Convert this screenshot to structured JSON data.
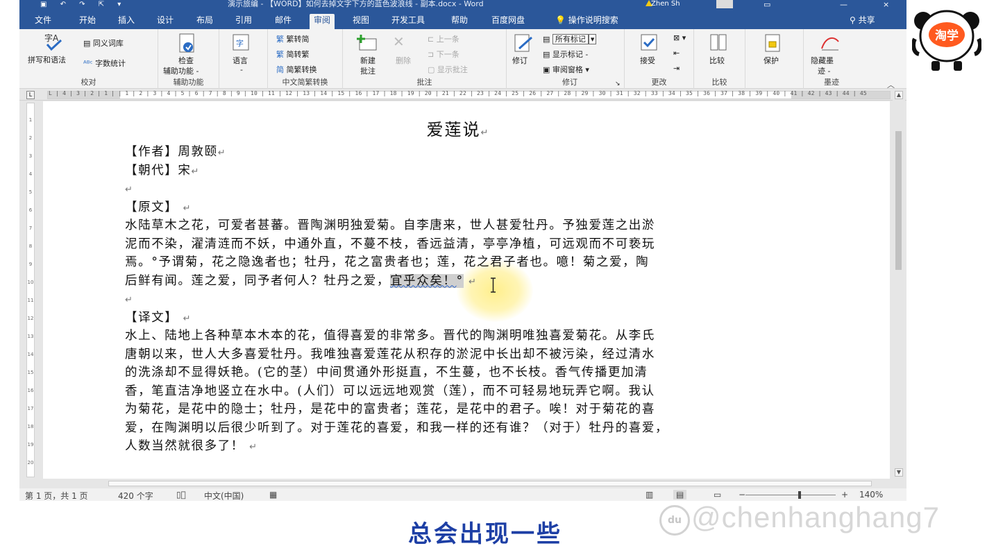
{
  "titlebar": {
    "title": "演示旅编 - 【WORD】如何去掉文字下方的蓝色波浪线 - 副本.docx - Word",
    "user": "Zhen Sh",
    "window_controls": [
      "—",
      "□",
      "×"
    ]
  },
  "tabs": [
    {
      "label": "文件",
      "active": false
    },
    {
      "label": "开始",
      "active": false
    },
    {
      "label": "插入",
      "active": false
    },
    {
      "label": "设计",
      "active": false
    },
    {
      "label": "布局",
      "active": false
    },
    {
      "label": "引用",
      "active": false
    },
    {
      "label": "邮件",
      "active": false
    },
    {
      "label": "审阅",
      "active": true
    },
    {
      "label": "视图",
      "active": false
    },
    {
      "label": "开发工具",
      "active": false
    },
    {
      "label": "帮助",
      "active": false
    },
    {
      "label": "百度网盘",
      "active": false
    }
  ],
  "tell_me": "操作说明搜索",
  "share": "共享",
  "ribbon": {
    "proofing": {
      "spell": "拼写和语法",
      "thesaurus": "同义词库",
      "wordcount": "字数统计",
      "label": "校对"
    },
    "accessibility": {
      "check": "检查",
      "check2": "辅助功能 -",
      "label": "辅助功能"
    },
    "language": {
      "lang": "语言",
      "arrow": "-"
    },
    "chinese": {
      "t2s": "繁转简",
      "s2t": "简转繁",
      "conv": "简繁转换",
      "label": "中文简繁转换"
    },
    "comments": {
      "new": "新建",
      "new2": "批注",
      "delete": "删除",
      "prev": "上一条",
      "next": "下一条",
      "show": "显示批注",
      "label": "批注"
    },
    "tracking": {
      "track": "修订",
      "markup": "所有标记",
      "showmarkup": "显示标记 -",
      "pane": "审阅窗格",
      "label": "修订"
    },
    "changes": {
      "accept": "接受",
      "label": "更改"
    },
    "compare": {
      "compare": "比较",
      "label": "比较"
    },
    "protect": {
      "protect": "保护"
    },
    "ink": {
      "hide": "隐藏墨",
      "hide2": "迹 -",
      "label": "墨迹"
    }
  },
  "ruler_text": "L | 4 | 3 | 2 | 1 |   | 1 | 2 | 3 | 4 | 5 | 6 | 7 | 8 | 9 | 10 | 11 | 12 | 13 | 14 | 15 | 16 | 17 | 18 | 19 | 20 | 21 | 22 | 23 | 24 | 25 | 26 | 27 | 28 | 29 | 30 | 31 | 32 | 33 | 34 | 35 | 36 | 37 | 38 | 39 | 40 | 41 | 42 | 43 | 44 | 45",
  "document": {
    "title": "爱莲说",
    "author": "【作者】周敦颐",
    "dynasty": "【朝代】宋",
    "original_heading": "【原文】",
    "original": [
      "水陆草木之花，可爱者甚蕃。晋陶渊明独爱菊。自李唐来，世人甚爱牡丹。予独爱莲之出淤",
      "泥而不染，濯清涟而不妖，中通外直，不蔓不枝，香远益清，亭亭净植，可远观而不可亵玩",
      "焉。°予谓菊，花之隐逸者也；牡丹，花之富贵者也；莲，花之君子者也。噫！菊之爱，陶"
    ],
    "original_last_a": "后鲜有闻。莲之爱，同予者何人？牡丹之爱，",
    "original_last_b": "宜乎众矣！",
    "original_last_c": "°",
    "translation_heading": "【译文】",
    "translation": [
      "水上、陆地上各种草本木本的花，值得喜爱的非常多。晋代的陶渊明唯独喜爱菊花。从李氏",
      "唐朝以来，世人大多喜爱牡丹。我唯独喜爱莲花从积存的淤泥中长出却不被污染，经过清水",
      "的洗涤却不显得妖艳。(它的茎）中间贯通外形挺直，不生蔓，也不长枝。香气传播更加清",
      "香，笔直洁净地竖立在水中。(人们）可以远远地观赏（莲），而不可轻易地玩弄它啊。我认",
      "为菊花，是花中的隐士；牡丹，是花中的富贵者；莲花，是花中的君子。唉！对于菊花的喜",
      "爱，在陶渊明以后很少听到了。对于莲花的喜爱，和我一样的还有谁？（对于）牡丹的喜爱，",
      "人数当然就很多了！"
    ]
  },
  "status": {
    "page": "第 1 页，共 1 页",
    "words": "420 个字",
    "lang": "中文(中国)",
    "zoom": "140%"
  },
  "mascot": {
    "label": "淘学"
  },
  "caption": "总会出现一些",
  "watermark": "@chenhanghang7",
  "watermark_logo": "du"
}
